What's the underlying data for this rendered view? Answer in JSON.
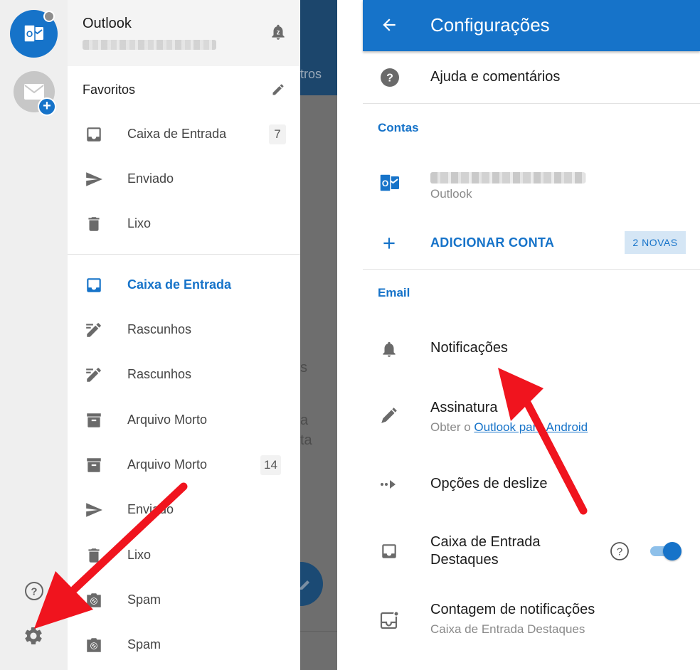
{
  "colors": {
    "accent": "#1673c9",
    "arrow": "#f0141e",
    "scrim": "#6e6e6e"
  },
  "drawer": {
    "title": "Outlook",
    "favorites_label": "Favoritos",
    "favorites": [
      {
        "label": "Caixa de Entrada",
        "count": "7",
        "icon": "inbox-icon"
      },
      {
        "label": "Enviado",
        "icon": "send-icon"
      },
      {
        "label": "Lixo",
        "icon": "trash-icon"
      }
    ],
    "folders": [
      {
        "label": "Caixa de Entrada",
        "icon": "inbox-icon",
        "active": true
      },
      {
        "label": "Rascunhos",
        "icon": "drafts-icon"
      },
      {
        "label": "Rascunhos",
        "icon": "drafts-icon"
      },
      {
        "label": "Arquivo Morto",
        "icon": "archive-icon"
      },
      {
        "label": "Arquivo Morto",
        "count": "14",
        "icon": "archive-icon"
      },
      {
        "label": "Enviado",
        "icon": "send-icon"
      },
      {
        "label": "Lixo",
        "icon": "trash-icon"
      },
      {
        "label": "Spam",
        "icon": "spam-icon"
      },
      {
        "label": "Spam",
        "icon": "spam-icon"
      }
    ]
  },
  "background_app": {
    "tab_fragment": "tros",
    "text_fragments": [
      "s",
      "a",
      "ta"
    ]
  },
  "settings": {
    "title": "Configurações",
    "help_feedback": "Ajuda e comentários",
    "accounts_header": "Contas",
    "account_type": "Outlook",
    "add_account": "ADICIONAR CONTA",
    "new_badge": "2 NOVAS",
    "email_header": "Email",
    "notifications": "Notificações",
    "signature": "Assinatura",
    "signature_sub_prefix": "Obter o ",
    "signature_link": "Outlook para Android",
    "swipe_options": "Opções de deslize",
    "focused_inbox_line1": "Caixa de Entrada",
    "focused_inbox_line2": "Destaques",
    "focused_inbox_enabled": true,
    "badge_count": "Contagem de notificações",
    "badge_count_sub": "Caixa de Entrada Destaques"
  }
}
